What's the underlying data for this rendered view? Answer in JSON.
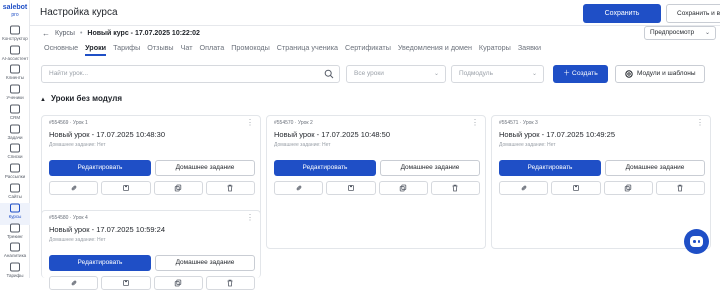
{
  "sidebar": {
    "logo_line1": "salebot",
    "logo_line2": "pro",
    "items": [
      {
        "label": "Конструктор",
        "icon": "constructor-icon"
      },
      {
        "label": "AI-ассистент",
        "icon": "ai-icon"
      },
      {
        "label": "Клиенты",
        "icon": "clients-icon"
      },
      {
        "label": "Ученики",
        "icon": "students-icon"
      },
      {
        "label": "CRM",
        "icon": "crm-icon"
      },
      {
        "label": "Задачи",
        "icon": "tasks-icon"
      },
      {
        "label": "Списки",
        "icon": "lists-icon"
      },
      {
        "label": "Рассылки",
        "icon": "mailing-icon"
      },
      {
        "label": "Сайты",
        "icon": "sites-icon"
      },
      {
        "label": "Курсы",
        "icon": "courses-icon",
        "active": true
      },
      {
        "label": "Трекинг",
        "icon": "tracking-icon"
      },
      {
        "label": "Аналитика",
        "icon": "analytics-icon"
      },
      {
        "label": "Тарифы",
        "icon": "tariffs-icon"
      }
    ]
  },
  "header": {
    "title": "Настройка курса",
    "save_label": "Сохранить",
    "save_exit_label": "Сохранить и выйти"
  },
  "breadcrumb": {
    "back": "Курсы",
    "course": "Новый курс - 17.07.2025 10:22:02"
  },
  "preview": {
    "label": "Предпросмотр"
  },
  "tabs": [
    "Основные",
    "Уроки",
    "Тарифы",
    "Отзывы",
    "Чат",
    "Оплата",
    "Промокоды",
    "Страница ученика",
    "Сертификаты",
    "Уведомления и домен",
    "Кураторы",
    "Заявки"
  ],
  "active_tab": "Уроки",
  "filters": {
    "search_placeholder": "Найти урок...",
    "lessons_select": "Все уроки",
    "module_select": "Подмодуль",
    "create_label": "Создать",
    "modules_label": "Модули и шаблоны"
  },
  "section": {
    "title": "Уроки без модуля"
  },
  "cards": [
    {
      "id": "#554569",
      "lesson": "Урок 1",
      "title": "Новый урок - 17.07.2025 10:48:30",
      "homework": "Домашнее задание: Нет",
      "edit": "Редактировать",
      "hw_btn": "Домашнее задание"
    },
    {
      "id": "#554570",
      "lesson": "Урок 2",
      "title": "Новый урок - 17.07.2025 10:48:50",
      "homework": "Домашнее задание: Нет",
      "edit": "Редактировать",
      "hw_btn": "Домашнее задание"
    },
    {
      "id": "#554571",
      "lesson": "Урок 3",
      "title": "Новый урок - 17.07.2025 10:49:25",
      "homework": "Домашнее задание: Нет",
      "edit": "Редактировать",
      "hw_btn": "Домашнее задание"
    },
    {
      "id": "#554580",
      "lesson": "Урок 4",
      "title": "Новый урок - 17.07.2025 10:59:24",
      "homework": "Домашнее задание: Нет",
      "edit": "Редактировать",
      "hw_btn": "Домашнее задание"
    }
  ],
  "colors": {
    "accent": "#1f4fc6",
    "border": "#e3e6ea"
  }
}
